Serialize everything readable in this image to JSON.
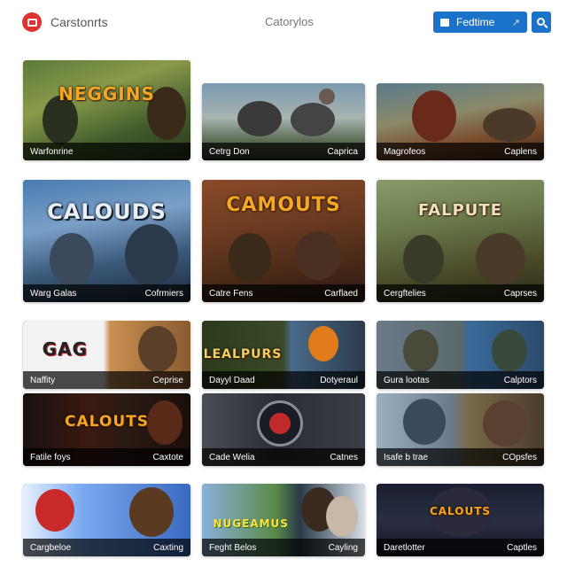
{
  "header": {
    "brand": "Carstonrts",
    "nav_label": "Catorylos",
    "primary_button_label": "Fedtime",
    "colors": {
      "accent": "#1a73c9",
      "logo": "#e0322e"
    }
  },
  "cards": [
    {
      "left": "Warfonrine",
      "right": "",
      "art_text": "NEGGINS"
    },
    {
      "left": "Cetrg Don",
      "right": "Caprica",
      "art_text": ""
    },
    {
      "left": "Magrofeos",
      "right": "Caplens",
      "art_text": ""
    },
    {
      "left": "Warg Galas",
      "right": "Cofrmiers",
      "art_text": "CALOUDS"
    },
    {
      "left": "Catre Fens",
      "right": "Carflaed",
      "art_text": "CAMOUTS"
    },
    {
      "left": "Cergftelies",
      "right": "Caprses",
      "art_text": "FALPUTE"
    },
    {
      "left": "Naffity",
      "right": "Ceprise",
      "art_text": "GAG"
    },
    {
      "left": "Dayyl Daad",
      "right": "Dotyeraul",
      "art_text": "LEALPURS"
    },
    {
      "left": "Gura lootas",
      "right": "Calptors",
      "art_text": ""
    },
    {
      "left": "Fatile foys",
      "right": "Caxtote",
      "art_text": "CALOUTS"
    },
    {
      "left": "Cade Welia",
      "right": "Catnes",
      "art_text": ""
    },
    {
      "left": "Isafe b trae",
      "right": "COpsfes",
      "art_text": ""
    },
    {
      "left": "Cargbeloe",
      "right": "Caxting",
      "art_text": ""
    },
    {
      "left": "Feght Belos",
      "right": "Cayling",
      "art_text": "NUGEAMUS"
    },
    {
      "left": "Daretlotter",
      "right": "Captles",
      "art_text": "CALOUTS"
    }
  ]
}
